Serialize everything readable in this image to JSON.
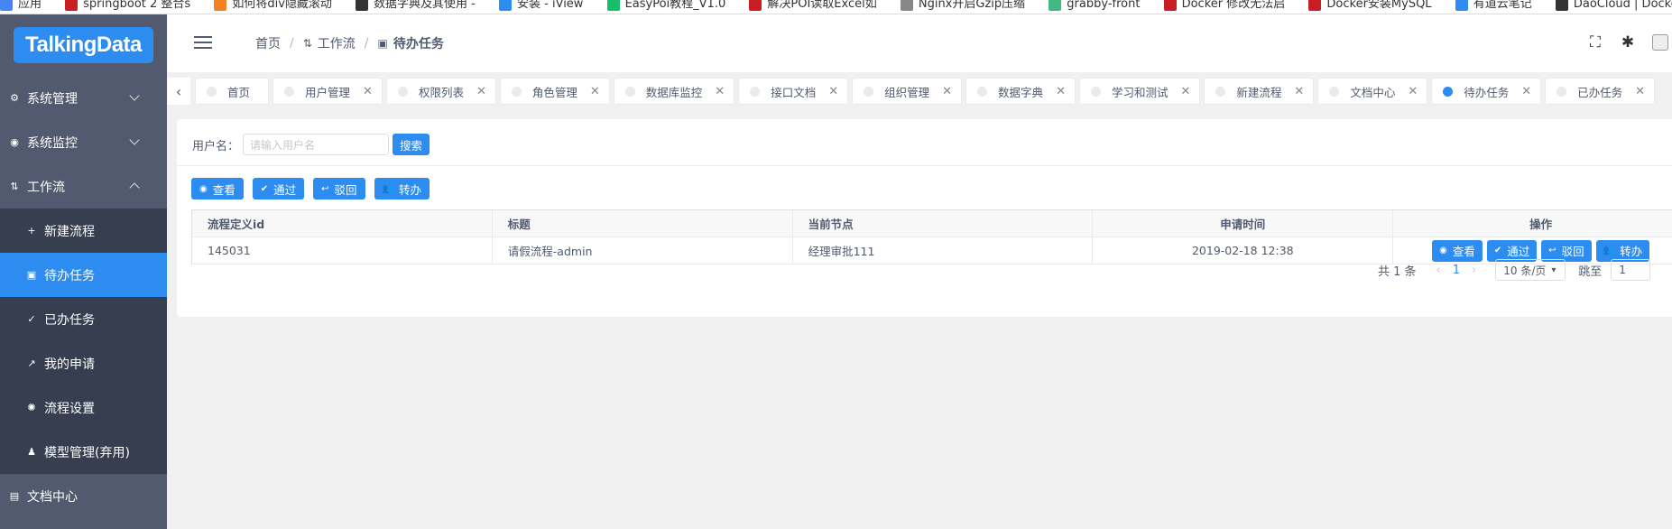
{
  "bookmarks": [
    {
      "label": "应用",
      "color": "#4285f4"
    },
    {
      "label": "springboot 2 整合s",
      "color": "#c71d23"
    },
    {
      "label": "如何将div隐藏滚动",
      "color": "#f48024"
    },
    {
      "label": "数据字典及其使用 -",
      "color": "#333333"
    },
    {
      "label": "安装 - iView",
      "color": "#2d8cf0"
    },
    {
      "label": "EasyPoi教程_V1.0",
      "color": "#19be6b"
    },
    {
      "label": "解决POI读取Excel如",
      "color": "#c71d23"
    },
    {
      "label": "Nginx开启Gzip压缩",
      "color": "#888888"
    },
    {
      "label": "grabby-front",
      "color": "#42b983"
    },
    {
      "label": "Docker 修改无法启",
      "color": "#c71d23"
    },
    {
      "label": "Docker安装MySQL",
      "color": "#c71d23"
    },
    {
      "label": "有道云笔记",
      "color": "#2d8cf0"
    },
    {
      "label": "DaoCloud | Docker",
      "color": "#333333"
    }
  ],
  "sidebar": {
    "logo": "TalkingData",
    "items": [
      {
        "label": "系统管理",
        "icon": "gear-icon"
      },
      {
        "label": "系统监控",
        "icon": "eye-icon"
      },
      {
        "label": "工作流",
        "icon": "workflow-icon"
      }
    ],
    "workflow_sub": [
      {
        "label": "新建流程",
        "icon": "plus-icon"
      },
      {
        "label": "待办任务",
        "icon": "briefcase-icon"
      },
      {
        "label": "已办任务",
        "icon": "done-icon"
      },
      {
        "label": "我的申请",
        "icon": "share-icon"
      },
      {
        "label": "流程设置",
        "icon": "settings-icon"
      },
      {
        "label": "模型管理(弃用)",
        "icon": "bell-icon"
      }
    ],
    "doc": {
      "label": "文档中心",
      "icon": "document-icon"
    }
  },
  "header": {
    "breadcrumb": [
      "首页",
      "工作流",
      "待办任务"
    ]
  },
  "tags": [
    "首页",
    "用户管理",
    "权限列表",
    "角色管理",
    "数据库监控",
    "接口文档",
    "组织管理",
    "数据字典",
    "学习和测试",
    "新建流程",
    "文档中心",
    "待办任务",
    "已办任务"
  ],
  "search": {
    "label": "用户名：",
    "placeholder": "请输入用户名",
    "button": "搜索"
  },
  "toolbar": {
    "view": "查看",
    "pass": "通过",
    "reject": "驳回",
    "transfer": "转办"
  },
  "table": {
    "columns": [
      "流程定义id",
      "标题",
      "当前节点",
      "申请时间",
      "操作"
    ],
    "rows": [
      {
        "id": "145031",
        "title": "请假流程-admin",
        "node": "经理审批111",
        "time": "2019-02-18 12:38"
      }
    ],
    "ops": [
      "查看",
      "通过",
      "驳回",
      "转办"
    ]
  },
  "pager": {
    "total": "共 1 条",
    "current": "1",
    "size": "10 条/页",
    "jump_label": "跳至",
    "jump_value": "1"
  },
  "colors": {
    "primary": "#2d8cf0",
    "sidebar": "#515a6e",
    "submenu": "#363e4f"
  }
}
